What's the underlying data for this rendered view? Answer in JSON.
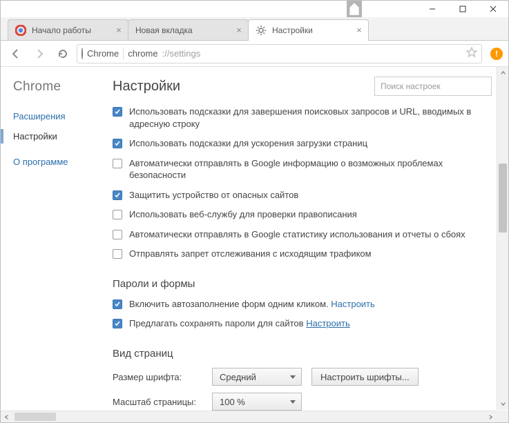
{
  "titlebar": {},
  "tabs": [
    {
      "title": "Начало работы",
      "active": false
    },
    {
      "title": "Новая вкладка",
      "active": false
    },
    {
      "title": "Настройки",
      "active": true
    }
  ],
  "toolbar": {
    "origin_label": "Chrome",
    "addr_host": "chrome",
    "addr_path": "://settings"
  },
  "sidebar": {
    "brand": "Chrome",
    "extensions": "Расширения",
    "settings": "Настройки",
    "about": "О программе"
  },
  "page": {
    "title": "Настройки",
    "search_placeholder": "Поиск настроек"
  },
  "privacy": {
    "opt1": "Использовать подсказки для завершения поисковых запросов и URL, вводимых в адресную строку",
    "opt2": "Использовать подсказки для ускорения загрузки страниц",
    "opt3": "Автоматически отправлять в Google информацию о возможных проблемах безопасности",
    "opt4": "Защитить устройство от опасных сайтов",
    "opt5": "Использовать веб-службу для проверки правописания",
    "opt6": "Автоматически отправлять в Google статистику использования и отчеты о сбоях",
    "opt7": "Отправлять запрет отслеживания с исходящим трафиком"
  },
  "passwords": {
    "title": "Пароли и формы",
    "opt1": "Включить автозаполнение форм одним кликом.",
    "opt2": "Предлагать сохранять пароли для сайтов",
    "configure": "Настроить"
  },
  "appearance": {
    "title": "Вид страниц",
    "font_size_label": "Размер шрифта:",
    "font_size_value": "Средний",
    "customize_fonts": "Настроить шрифты...",
    "zoom_label": "Масштаб страницы:",
    "zoom_value": "100 %"
  }
}
